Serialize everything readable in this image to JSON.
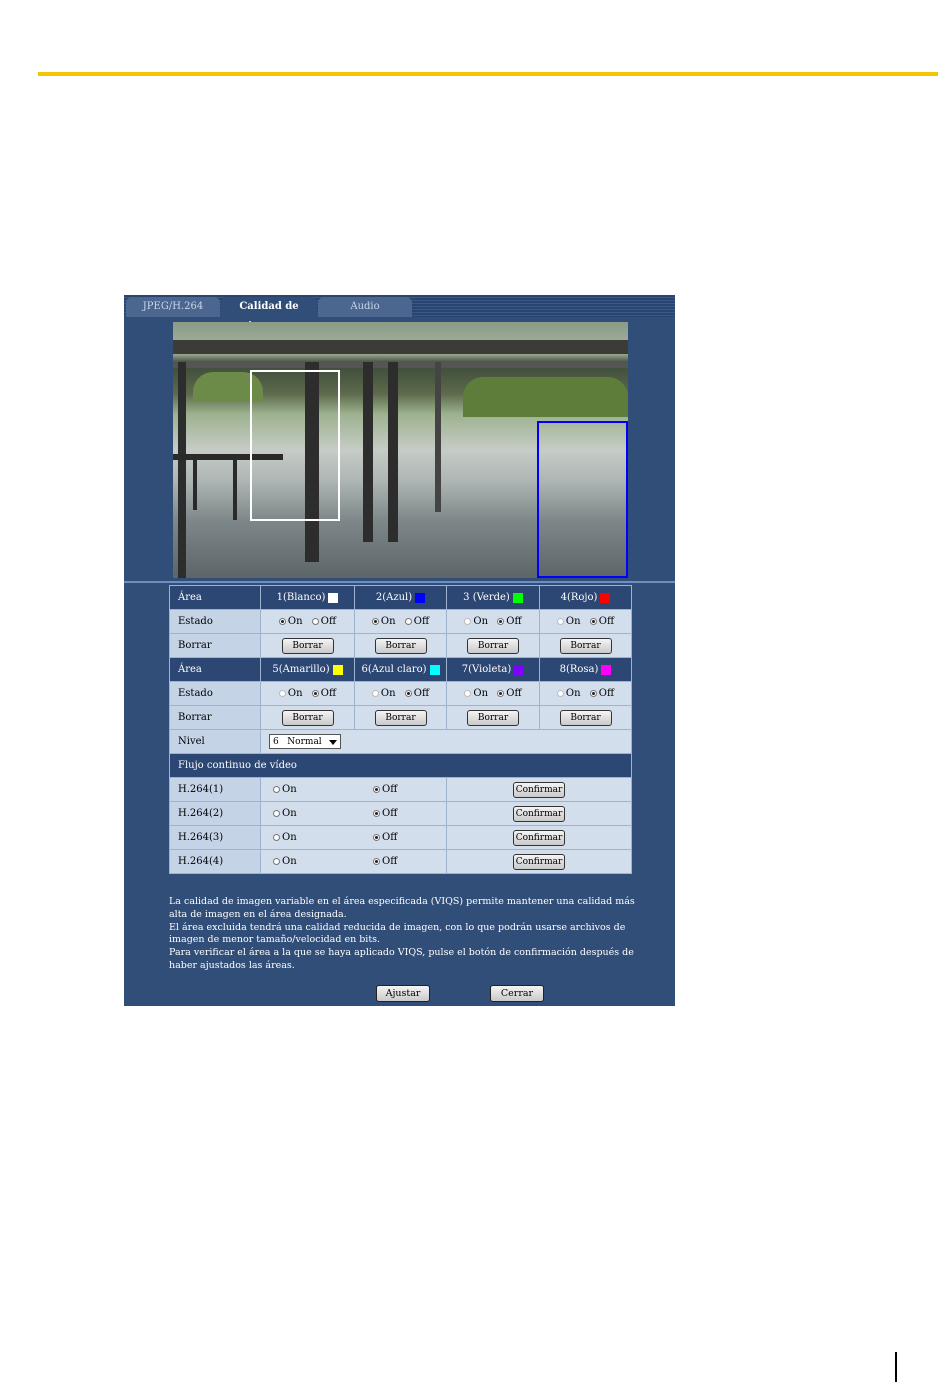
{
  "colors": {
    "accent_line": "#f2c500",
    "panel_bg": "#314e79"
  },
  "tabs": [
    {
      "label": "JPEG/H.264",
      "active": false
    },
    {
      "label": "Calidad de imagen",
      "active": true
    },
    {
      "label": "Audio",
      "active": false
    }
  ],
  "areas_row1": [
    {
      "name": "1(Blanco)",
      "color": "#ffffff",
      "estado": "On"
    },
    {
      "name": "2(Azul)",
      "color": "#0000ff",
      "estado": "On"
    },
    {
      "name": "3 (Verde)",
      "color": "#00ff00",
      "estado": "Off"
    },
    {
      "name": "4(Rojo)",
      "color": "#ff0000",
      "estado": "Off"
    }
  ],
  "areas_row2": [
    {
      "name": "5(Amarillo)",
      "color": "#ffff00",
      "estado": "Off"
    },
    {
      "name": "6(Azul claro)",
      "color": "#00ffff",
      "estado": "Off"
    },
    {
      "name": "7(Violeta)",
      "color": "#8000ff",
      "estado": "Off"
    },
    {
      "name": "8(Rosa)",
      "color": "#ff00ff",
      "estado": "Off"
    }
  ],
  "labels": {
    "area": "Área",
    "estado": "Estado",
    "borrar": "Borrar",
    "on": "On",
    "off": "Off",
    "nivel": "Nivel",
    "flujo": "Flujo continuo de vídeo",
    "borrar_btn": "Borrar",
    "confirmar_btn": "Confirmar"
  },
  "nivel": {
    "selected": "6   Normal"
  },
  "h264_rows": [
    {
      "label": "H.264(1)",
      "value": "Off"
    },
    {
      "label": "H.264(2)",
      "value": "Off"
    },
    {
      "label": "H.264(3)",
      "value": "Off"
    },
    {
      "label": "H.264(4)",
      "value": "Off"
    }
  ],
  "description": [
    "La calidad de imagen variable en el área especificada (VIQS) permite mantener una calidad más alta de imagen en el área designada.",
    "El área excluida tendrá una calidad reducida de imagen, con lo que podrán usarse archivos de imagen de menor tamaño/velocidad en bits.",
    "Para verificar el área a la que se haya aplicado VIQS, pulse el botón de confirmación después de haber ajustados las áreas."
  ],
  "buttons": {
    "ajustar": "Ajustar",
    "cerrar": "Cerrar"
  }
}
